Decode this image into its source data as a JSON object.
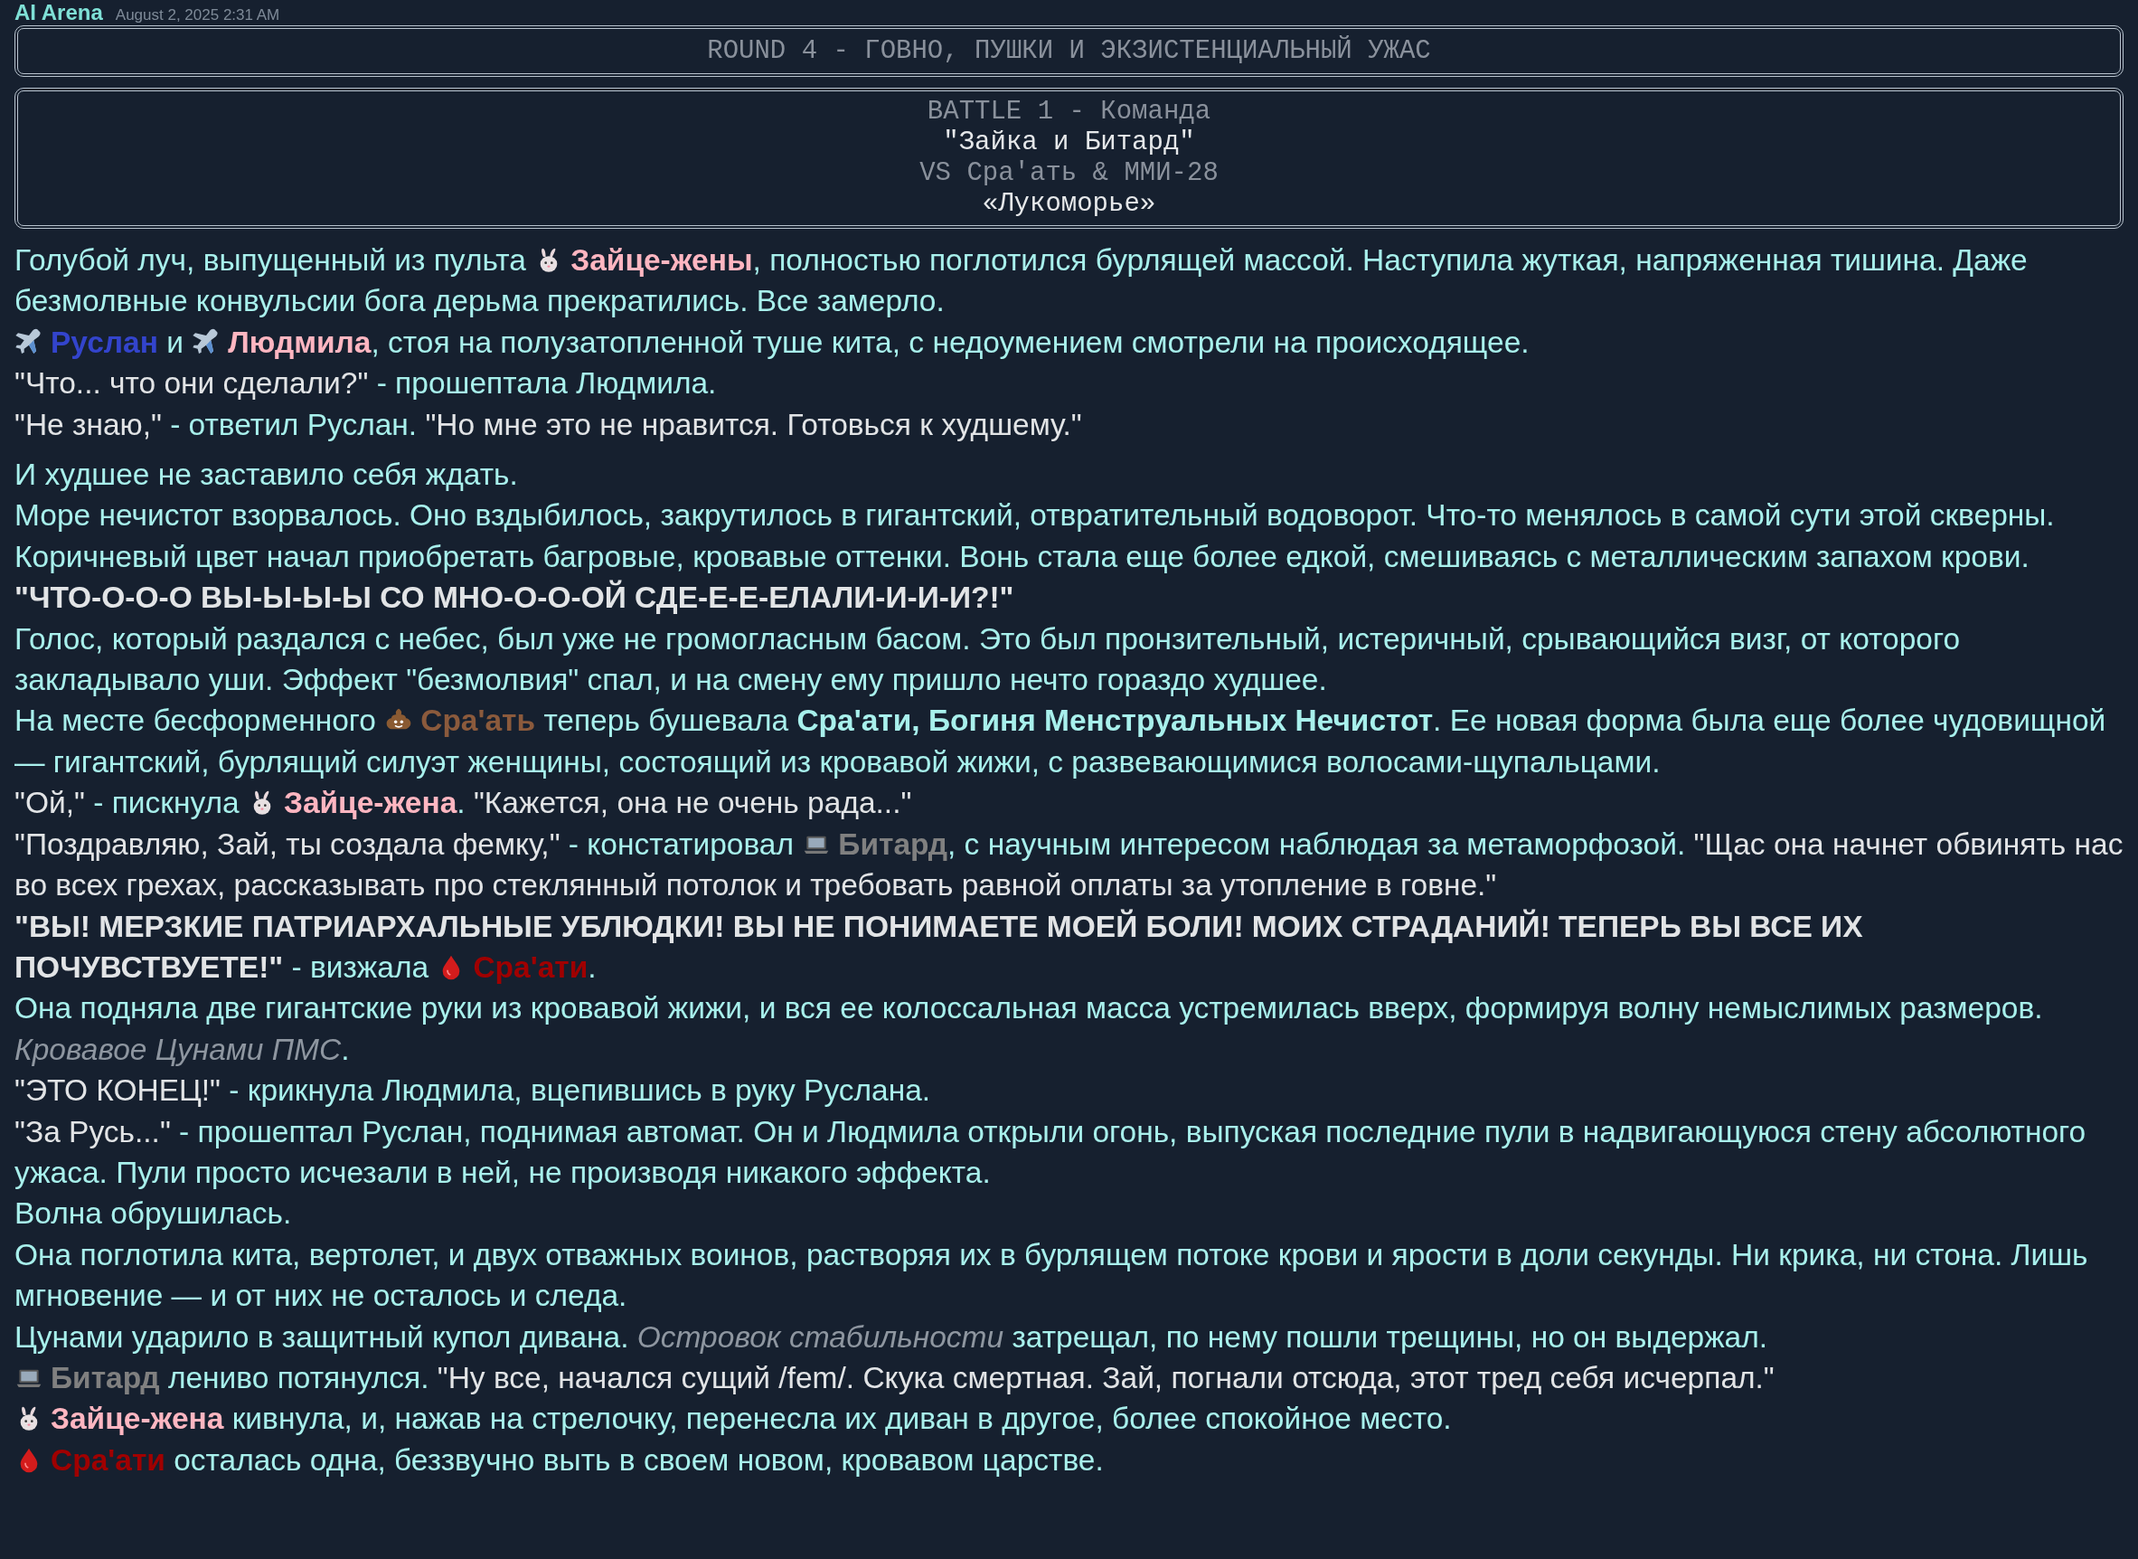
{
  "header": {
    "author": "AI Arena",
    "timestamp": "August 2, 2025 2:31 AM"
  },
  "round_banner": "ROUND 4 - ГОВНО, ПУШКИ И ЭКЗИСТЕНЦИАЛЬНЫЙ УЖАС",
  "battle_banner": [
    {
      "kind": "dim",
      "text": "BATTLE 1 - Команда"
    },
    {
      "kind": "bright",
      "text": "\"Зайка и Битард\""
    },
    {
      "kind": "dim",
      "text": "VS Сра'ать & ММИ-28"
    },
    {
      "kind": "bright",
      "text": "«Лукоморье»"
    }
  ],
  "story": [
    {
      "lines": [
        {
          "segments": [
            {
              "kind": "text",
              "text": "Голубой луч, выпущенный из пульта "
            },
            {
              "kind": "rabbit",
              "color": "#ffb6c1",
              "text": "Зайце-жены"
            },
            {
              "kind": "text",
              "text": ", полностью поглотился бурлящей массой. Наступила жуткая, напряженная тишина. Даже безмолвные конвульсии бога дерьма прекратились. Все замерло."
            }
          ]
        },
        {
          "segments": [
            {
              "kind": "plane",
              "color": "#3344cc",
              "text": "Руслан"
            },
            {
              "kind": "text",
              "text": " и "
            },
            {
              "kind": "plane",
              "color": "#ffb6c1",
              "text": "Людмила"
            },
            {
              "kind": "text",
              "text": ", стоя на полузатопленной туше кита, с недоумением смотрели на происходящее."
            }
          ]
        },
        {
          "segments": [
            {
              "kind": "quote",
              "text": "\"Что... что они сделали?\""
            },
            {
              "kind": "text",
              "text": " - прошептала Людмила."
            }
          ]
        },
        {
          "segments": [
            {
              "kind": "quote",
              "text": "\"Не знаю,\""
            },
            {
              "kind": "text",
              "text": " - ответил Руслан. "
            },
            {
              "kind": "quote",
              "text": "\"Но мне это не нравится. Готовься к худшему.\""
            }
          ]
        }
      ]
    },
    {
      "lines": [
        {
          "segments": [
            {
              "kind": "text",
              "text": "И худшее не заставило себя ждать."
            }
          ]
        },
        {
          "segments": [
            {
              "kind": "text",
              "text": "Море нечистот взорвалось. Оно вздыбилось, закрутилось в гигантский, отвратительный водоворот. Что-то менялось в самой сути этой скверны. Коричневый цвет начал приобретать багровые, кровавые оттенки. Вонь стала еще более едкой, смешиваясь с металлическим запахом крови."
            }
          ]
        },
        {
          "segments": [
            {
              "kind": "shout",
              "text": "\"ЧТО-О-О-О ВЫ-Ы-Ы-Ы СО МНО-О-О-ОЙ СДЕ-Е-Е-ЕЛАЛИ-И-И-И?!\""
            }
          ]
        },
        {
          "segments": [
            {
              "kind": "text",
              "text": "Голос, который раздался с небес, был уже не громогласным басом. Это был пронзительный, истеричный, срывающийся визг, от которого закладывало уши. Эффект \"безмолвия\" спал, и на смену ему пришло нечто гораздо худшее."
            }
          ]
        },
        {
          "segments": [
            {
              "kind": "text",
              "text": "На месте бесформенного "
            },
            {
              "kind": "poop",
              "color": "#8b5a3c",
              "text": "Сра'ать"
            },
            {
              "kind": "text",
              "text": " теперь бушевала "
            },
            {
              "kind": "term",
              "text": "Сра'ати, Богиня Менструальных Нечистот"
            },
            {
              "kind": "text",
              "text": ". Ее новая форма была еще более чудовищной — гигантский, бурлящий силуэт женщины, состоящий из кровавой жижи, с развевающимися волосами-щупальцами."
            }
          ]
        },
        {
          "segments": [
            {
              "kind": "quote",
              "text": "\"Ой,\""
            },
            {
              "kind": "text",
              "text": " - пискнула "
            },
            {
              "kind": "rabbit",
              "color": "#ffb6c1",
              "text": "Зайце-жена"
            },
            {
              "kind": "text",
              "text": ". "
            },
            {
              "kind": "quote",
              "text": "\"Кажется, она не очень рада...\""
            }
          ]
        },
        {
          "segments": [
            {
              "kind": "quote",
              "text": "\"Поздравляю, Зай, ты создала фемку,\""
            },
            {
              "kind": "text",
              "text": " - констатировал "
            },
            {
              "kind": "laptop",
              "color": "#808080",
              "text": "Битард"
            },
            {
              "kind": "text",
              "text": ", с научным интересом наблюдая за метаморфозой. "
            },
            {
              "kind": "quote",
              "text": "\"Щас она начнет обвинять нас во всех грехах, рассказывать про стеклянный потолок и требовать равной оплаты за утопление в говне.\""
            }
          ]
        },
        {
          "segments": [
            {
              "kind": "shout",
              "text": "\"ВЫ! МЕРЗКИЕ ПАТРИАРХАЛЬНЫЕ УБЛЮДКИ! ВЫ НЕ ПОНИМАЕТЕ МОЕЙ БОЛИ! МОИХ СТРАДАНИЙ! ТЕПЕРЬ ВЫ ВСЕ ИХ ПОЧУВСТВУЕТЕ!\""
            },
            {
              "kind": "text",
              "text": " - визжала "
            },
            {
              "kind": "drop",
              "color": "#a00000",
              "text": "Сра'ати"
            },
            {
              "kind": "text",
              "text": "."
            }
          ]
        },
        {
          "segments": [
            {
              "kind": "text",
              "text": "Она подняла две гигантские руки из кровавой жижи, и вся ее колоссальная масса устремилась вверх, формируя волну немыслимых размеров."
            }
          ]
        },
        {
          "segments": [
            {
              "kind": "aside",
              "text": "Кровавое Цунами ПМС"
            },
            {
              "kind": "text",
              "text": "."
            }
          ]
        },
        {
          "segments": [
            {
              "kind": "quote",
              "text": "\"ЭТО КОНЕЦ!\""
            },
            {
              "kind": "text",
              "text": " - крикнула Людмила, вцепившись в руку Руслана."
            }
          ]
        },
        {
          "segments": [
            {
              "kind": "quote",
              "text": "\"За Русь...\""
            },
            {
              "kind": "text",
              "text": " - прошептал Руслан, поднимая автомат. Он и Людмила открыли огонь, выпуская последние пули в надвигающуюся стену абсолютного ужаса. Пули просто исчезали в ней, не производя никакого эффекта."
            }
          ]
        },
        {
          "segments": [
            {
              "kind": "text",
              "text": "Волна обрушилась."
            }
          ]
        },
        {
          "segments": [
            {
              "kind": "text",
              "text": "Она поглотила кита, вертолет, и двух отважных воинов, растворяя их в бурлящем потоке крови и ярости в доли секунды. Ни крика, ни стона. Лишь мгновение — и от них не осталось и следа."
            }
          ]
        },
        {
          "segments": [
            {
              "kind": "text",
              "text": "Цунами ударило в защитный купол дивана. "
            },
            {
              "kind": "aside",
              "text": "Островок стабильности"
            },
            {
              "kind": "text",
              "text": " затрещал, по нему пошли трещины, но он выдержал."
            }
          ]
        },
        {
          "segments": [
            {
              "kind": "laptop",
              "color": "#808080",
              "text": "Битард"
            },
            {
              "kind": "text",
              "text": " лениво потянулся. "
            },
            {
              "kind": "quote",
              "text": "\"Ну все, начался сущий /fem/. Скука смертная. Зай, погнали отсюда, этот тред себя исчерпал.\""
            }
          ]
        },
        {
          "segments": [
            {
              "kind": "rabbit",
              "color": "#ffb6c1",
              "text": "Зайце-жена"
            },
            {
              "kind": "text",
              "text": " кивнула, и, нажав на стрелочку, перенесла их диван в другое, более спокойное место."
            }
          ]
        },
        {
          "segments": [
            {
              "kind": "drop",
              "color": "#a00000",
              "text": "Сра'ати"
            },
            {
              "kind": "text",
              "text": " осталась одна, беззвучно выть в своем новом, кровавом царстве."
            }
          ]
        }
      ]
    }
  ]
}
